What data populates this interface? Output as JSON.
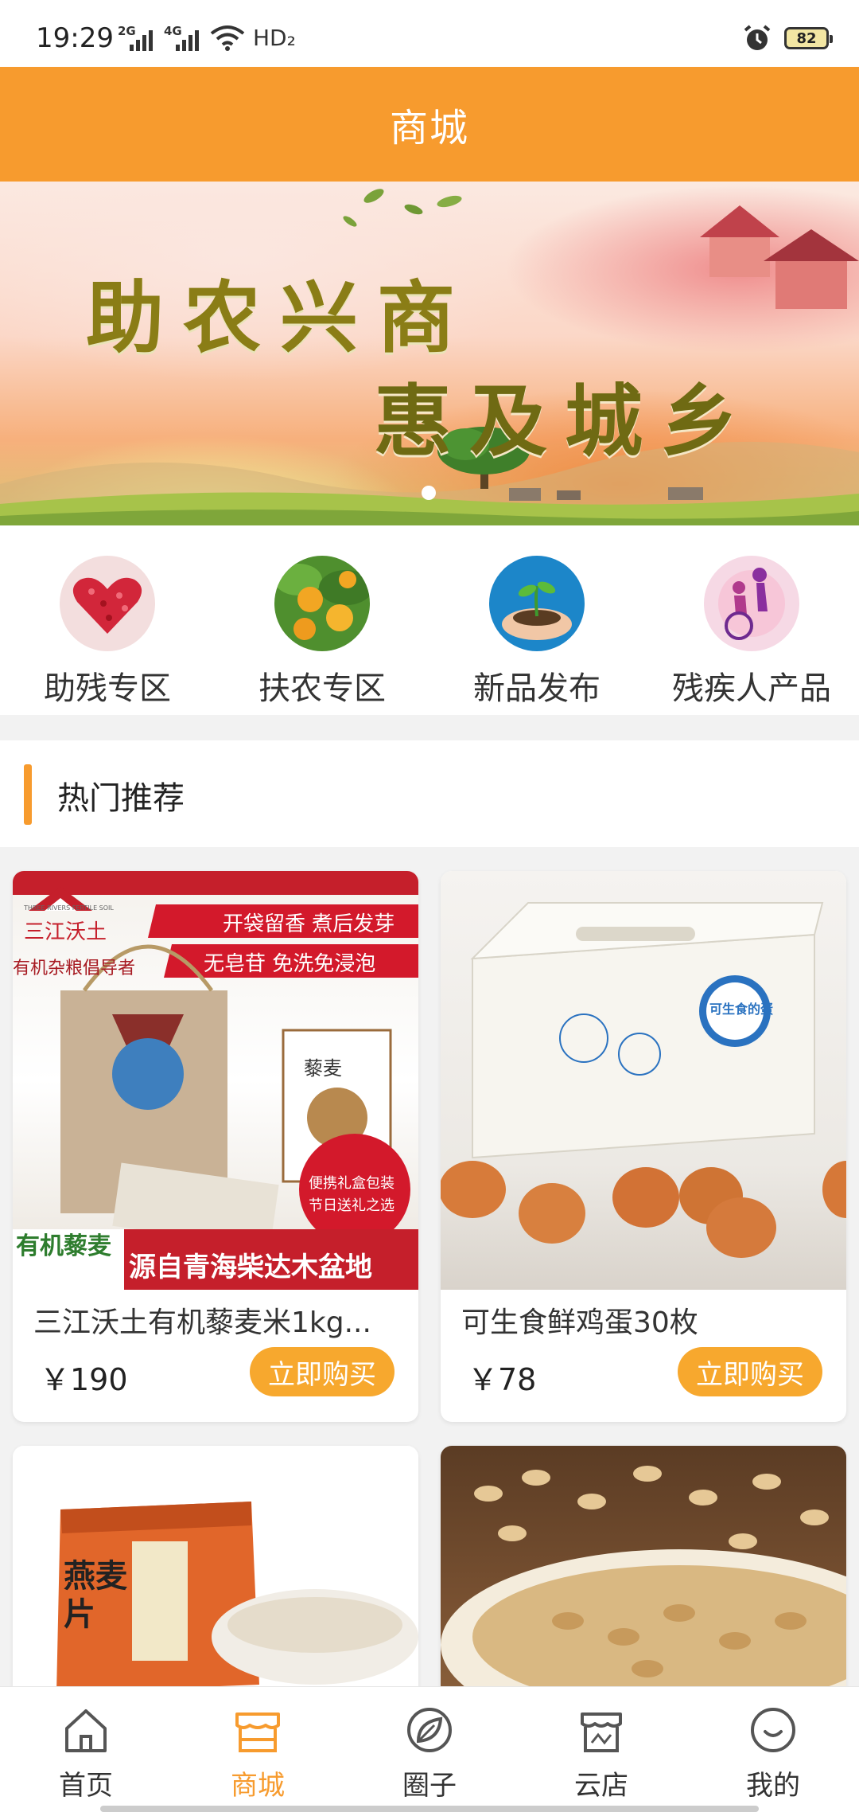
{
  "status_bar": {
    "time": "19:29",
    "network_1": "2G",
    "network_2": "4G",
    "hd": "HD₂",
    "battery": "82"
  },
  "title": "商城",
  "banner": {
    "line1": "助农兴商",
    "line2": "惠及城乡"
  },
  "categories": [
    {
      "label": "助残专区",
      "icon": "heart-icon"
    },
    {
      "label": "扶农专区",
      "icon": "orange-tree-icon"
    },
    {
      "label": "新品发布",
      "icon": "sprout-in-hands-icon"
    },
    {
      "label": "残疾人产品",
      "icon": "wheelchair-icon"
    }
  ],
  "section": {
    "title": "热门推荐"
  },
  "products": [
    {
      "name": "三江沃土有机藜麦米1kg...",
      "price": "￥190",
      "buy_label": "立即购买",
      "image_text": {
        "brand": "三江沃土",
        "brand_en": "THREE RIVERS FERTILE SOIL",
        "slogan": "有机杂粮倡导者",
        "tag1": "开袋留香 煮后发芽",
        "tag2": "无皂苷 免洗免浸泡",
        "badge_line1": "便携礼盒包装",
        "badge_line2": "节日送礼之选",
        "bottom_left": "有机藜麦",
        "bottom_right": "源自青海柴达木盆地",
        "pack_label": "藜麦"
      }
    },
    {
      "name": "可生食鲜鸡蛋30枚",
      "price": "￥78",
      "buy_label": "立即购买",
      "image_text": {
        "box_label": "可生食的蛋"
      }
    },
    {
      "name": "",
      "image_text": {
        "pack_label": "燕麦片"
      }
    },
    {
      "name": ""
    }
  ],
  "nav": [
    {
      "label": "首页",
      "icon": "home-icon",
      "active": false
    },
    {
      "label": "商城",
      "icon": "shop-icon",
      "active": true
    },
    {
      "label": "圈子",
      "icon": "circle-leaf-icon",
      "active": false
    },
    {
      "label": "云店",
      "icon": "store-icon",
      "active": false
    },
    {
      "label": "我的",
      "icon": "smile-icon",
      "active": false
    }
  ],
  "colors": {
    "primary": "#f79b2e",
    "buy_button": "#f7a82e"
  }
}
